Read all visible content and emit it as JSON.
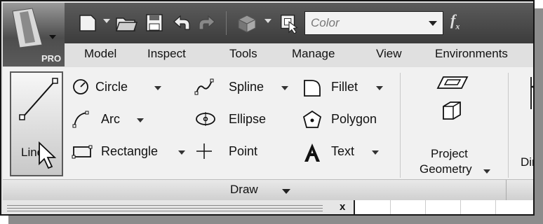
{
  "app": {
    "edition_badge": "PRO"
  },
  "quick_access": {
    "style_combo_value": "Color",
    "formula_label": "f",
    "formula_sub": "x"
  },
  "tabs": [
    "Model",
    "Inspect",
    "Tools",
    "Manage",
    "View",
    "Environments"
  ],
  "draw_panel": {
    "title": "Draw",
    "line_label": "Line",
    "commands": {
      "circle": "Circle",
      "arc": "Arc",
      "rectangle": "Rectangle",
      "spline": "Spline",
      "ellipse": "Ellipse",
      "point": "Point",
      "fillet": "Fillet",
      "polygon": "Polygon",
      "text": "Text"
    }
  },
  "project_panel": {
    "line1": "Project",
    "line2": "Geometry"
  },
  "dim_panel": {
    "label": "Dim"
  },
  "browser": {
    "close_label": "x"
  }
}
